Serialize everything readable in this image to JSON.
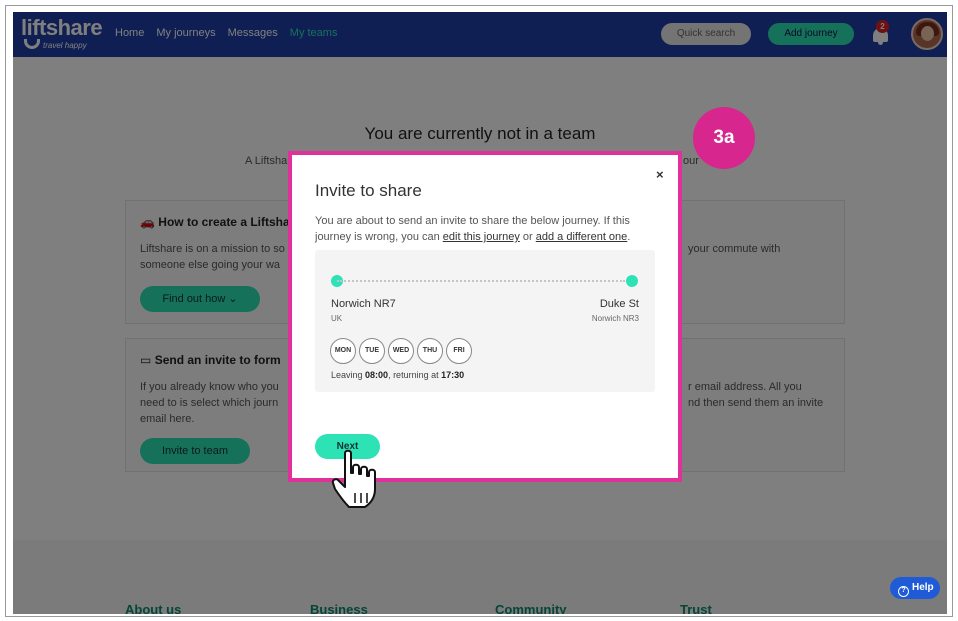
{
  "nav": {
    "logo_text": "liftshare",
    "logo_tagline": "travel happy",
    "links": [
      "Home",
      "My journeys",
      "Messages",
      "My teams"
    ],
    "active_link": "My teams",
    "quick_search": "Quick search",
    "add_journey": "Add journey",
    "notification_count": "2"
  },
  "page": {
    "title": "You are currently not in a team",
    "subtitle_left": "A Liftshare",
    "subtitle_right": "our",
    "card1": {
      "title": "How to create a Liftsha",
      "line1_left": "Liftshare is on a mission to so",
      "line1_right": "your commute with",
      "line2_left": "someone else going your wa",
      "button": "Find out how"
    },
    "card2": {
      "title": "Send an invite to form",
      "line1_left": "If you already know who you",
      "line1_right": "r email address. All you",
      "line2_left": "need to is select which journ",
      "line2_right": "nd then send them an invite",
      "line3_left": "email here.",
      "button": "Invite to team"
    }
  },
  "footer": {
    "columns": [
      "About us",
      "Business",
      "Community",
      "Trust"
    ]
  },
  "help": "Help",
  "modal": {
    "close": "×",
    "title": "Invite to share",
    "text_before": "You are about to send an invite to share the below journey. If this journey is wrong, you can ",
    "link_edit": "edit this journey",
    "text_middle": " or ",
    "link_add": "add a different one",
    "text_after": ".",
    "journey": {
      "from": "Norwich NR7",
      "from_sub": "UK",
      "to": "Duke St",
      "to_sub": "Norwich NR3",
      "days": [
        "MON",
        "TUE",
        "WED",
        "THU",
        "FRI"
      ],
      "leaving_label": "Leaving ",
      "leaving_time": "08:00",
      "returning_label": ", returning at ",
      "returning_time": "17:30"
    },
    "next_button": "Next"
  },
  "step_label": "3a",
  "colors": {
    "nav_blue": "#1e3fa8",
    "accent_green": "#2de3b6",
    "highlight_pink": "#e0309a",
    "help_blue": "#1f5bd6"
  }
}
